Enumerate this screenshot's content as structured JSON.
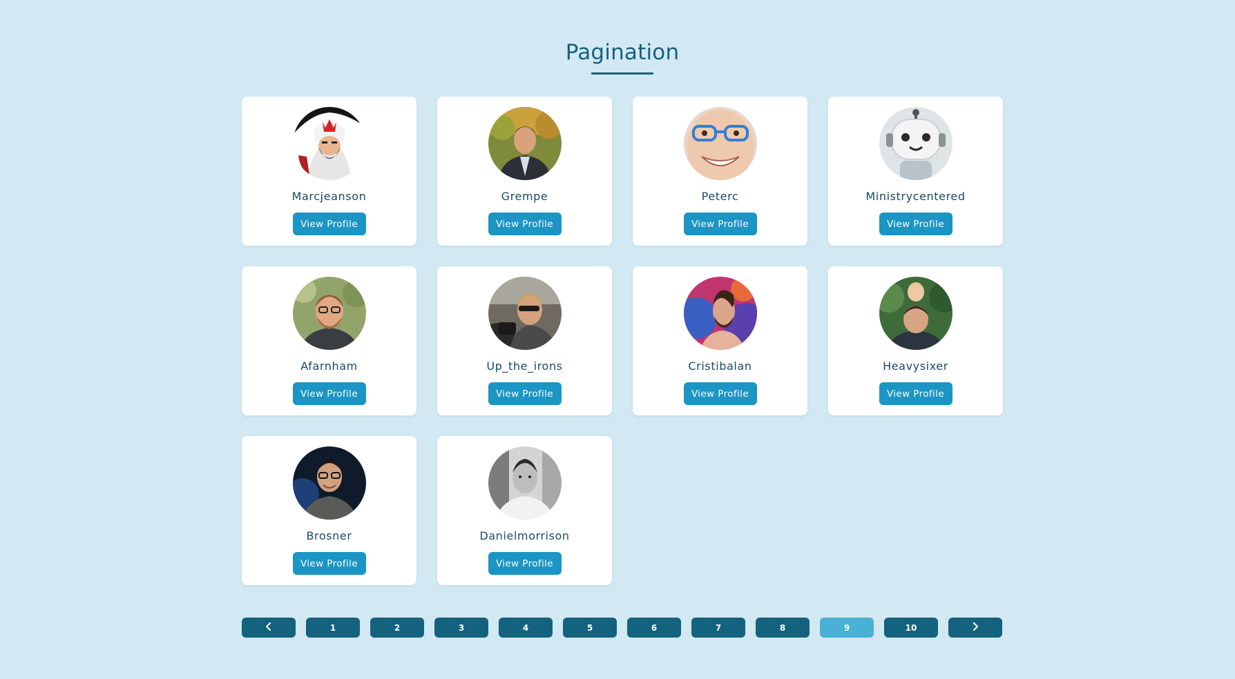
{
  "page": {
    "title": "Pagination"
  },
  "profiles": [
    {
      "username": "Marcjeanson",
      "button": "View Profile",
      "avatar": "avatar-marcjeanson"
    },
    {
      "username": "Grempe",
      "button": "View Profile",
      "avatar": "avatar-grempe"
    },
    {
      "username": "Peterc",
      "button": "View Profile",
      "avatar": "avatar-peterc"
    },
    {
      "username": "Ministrycentered",
      "button": "View Profile",
      "avatar": "avatar-ministrycentered"
    },
    {
      "username": "Afarnham",
      "button": "View Profile",
      "avatar": "avatar-afarnham"
    },
    {
      "username": "Up_the_irons",
      "button": "View Profile",
      "avatar": "avatar-up-the-irons"
    },
    {
      "username": "Cristibalan",
      "button": "View Profile",
      "avatar": "avatar-cristibalan"
    },
    {
      "username": "Heavysixer",
      "button": "View Profile",
      "avatar": "avatar-heavysixer"
    },
    {
      "username": "Brosner",
      "button": "View Profile",
      "avatar": "avatar-brosner"
    },
    {
      "username": "Danielmorrison",
      "button": "View Profile",
      "avatar": "avatar-danielmorrison"
    }
  ],
  "pagination": {
    "prev_icon": "chevron-left-icon",
    "next_icon": "chevron-right-icon",
    "pages": [
      "1",
      "2",
      "3",
      "4",
      "5",
      "6",
      "7",
      "8",
      "9",
      "10"
    ],
    "current_page": "9"
  },
  "colors": {
    "background": "#d2e9f3",
    "accent": "#1a95c4",
    "page_button": "#13627e",
    "page_button_active": "#49b1d6",
    "title": "#166080"
  }
}
